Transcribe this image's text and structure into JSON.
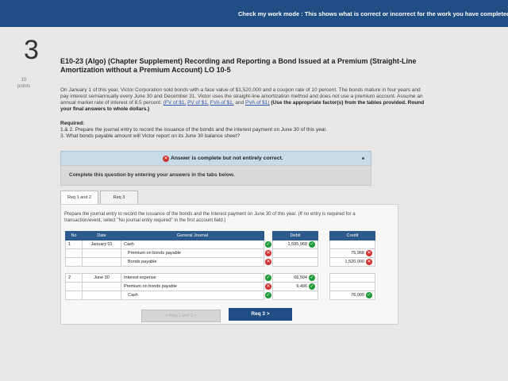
{
  "header": {
    "mode_text": "Check my work mode : This shows what is correct or incorrect for the work you have completed so"
  },
  "question": {
    "number": "3",
    "points_value": "10",
    "points_label": "points",
    "title": "E10-23 (Algo) (Chapter Supplement) Recording and Reporting a Bond Issued at a Premium (Straight-Line Amortization without a Premium Account) LO 10-5",
    "paragraph_main": "On January 1 of this year, Victor Corporation sold bonds with a face value of $1,520,000 and a coupon rate of 10 percent. The bonds mature in four years and pay interest semiannually every June 30 and December 31. Victor uses the straight-line amortization method and does not use a premium account. Assume an annual market rate of interest of 8.5 percent. ",
    "link1": "(FV of $1,",
    "link2": "PV of $1,",
    "link3": "FVA of $1,",
    "link_and": " and ",
    "link4": "PVA of $1)",
    "bold_note": " (Use the appropriate factor(s) from the tables provided. Round your final answers to whole dollars.)",
    "required_heading": "Required:",
    "req_1": "1.& 2. Prepare the journal entry to record the issuance of the bonds and the interest payment on June 30 of this year.",
    "req_2": "3. What bonds payable amount will Victor report on its June 30 balance sheet?"
  },
  "status": {
    "text": "Answer is complete but not entirely correct."
  },
  "complete_banner": {
    "text": "Complete this question by entering your answers in the tabs below."
  },
  "tabs": [
    {
      "label": "Req 1 and 2"
    },
    {
      "label": "Req 3"
    }
  ],
  "panel": {
    "instruction": "Prepare the journal entry to record the issuance of the bonds and the interest payment on June 30 of this year. (If no entry is required for a transaction/event, select \"No journal entry required\" in the first account field.)"
  },
  "journal": {
    "headers": {
      "no": "No",
      "date": "Date",
      "account": "General Journal",
      "debit": "Debit",
      "credit": "Credit"
    },
    "rows": [
      {
        "no": "1",
        "date": "January 01",
        "account": "Cash",
        "indent": false,
        "status": "correct",
        "debit": "1,595,968",
        "debit_status": "correct",
        "credit": "",
        "credit_status": ""
      },
      {
        "no": "",
        "date": "",
        "account": "Premium on bonds payable",
        "indent": true,
        "status": "incorrect",
        "debit": "",
        "debit_status": "",
        "credit": "75,968",
        "credit_status": "incorrect"
      },
      {
        "no": "",
        "date": "",
        "account": "Bonds payable",
        "indent": true,
        "status": "incorrect",
        "debit": "",
        "debit_status": "",
        "credit": "1,520,000",
        "credit_status": "incorrect"
      },
      {
        "no": "2",
        "date": "June 30",
        "account": "Interest expense",
        "indent": false,
        "status": "correct",
        "debit": "66,504",
        "debit_status": "correct",
        "credit": "",
        "credit_status": ""
      },
      {
        "no": "",
        "date": "",
        "account": "Premium on bonds payable",
        "indent": false,
        "status": "incorrect",
        "debit": "9,496",
        "debit_status": "correct",
        "credit": "",
        "credit_status": ""
      },
      {
        "no": "",
        "date": "",
        "account": "Cash",
        "indent": true,
        "status": "correct",
        "debit": "",
        "debit_status": "",
        "credit": "76,000",
        "credit_status": "correct"
      }
    ]
  },
  "nav": {
    "prev_label": "Req 1 and 2",
    "next_label": "Req 3"
  },
  "colors": {
    "topbar": "#1f4e84",
    "correct": "#1f9a3a",
    "incorrect": "#d03030",
    "table_header": "#2d5a8c"
  }
}
